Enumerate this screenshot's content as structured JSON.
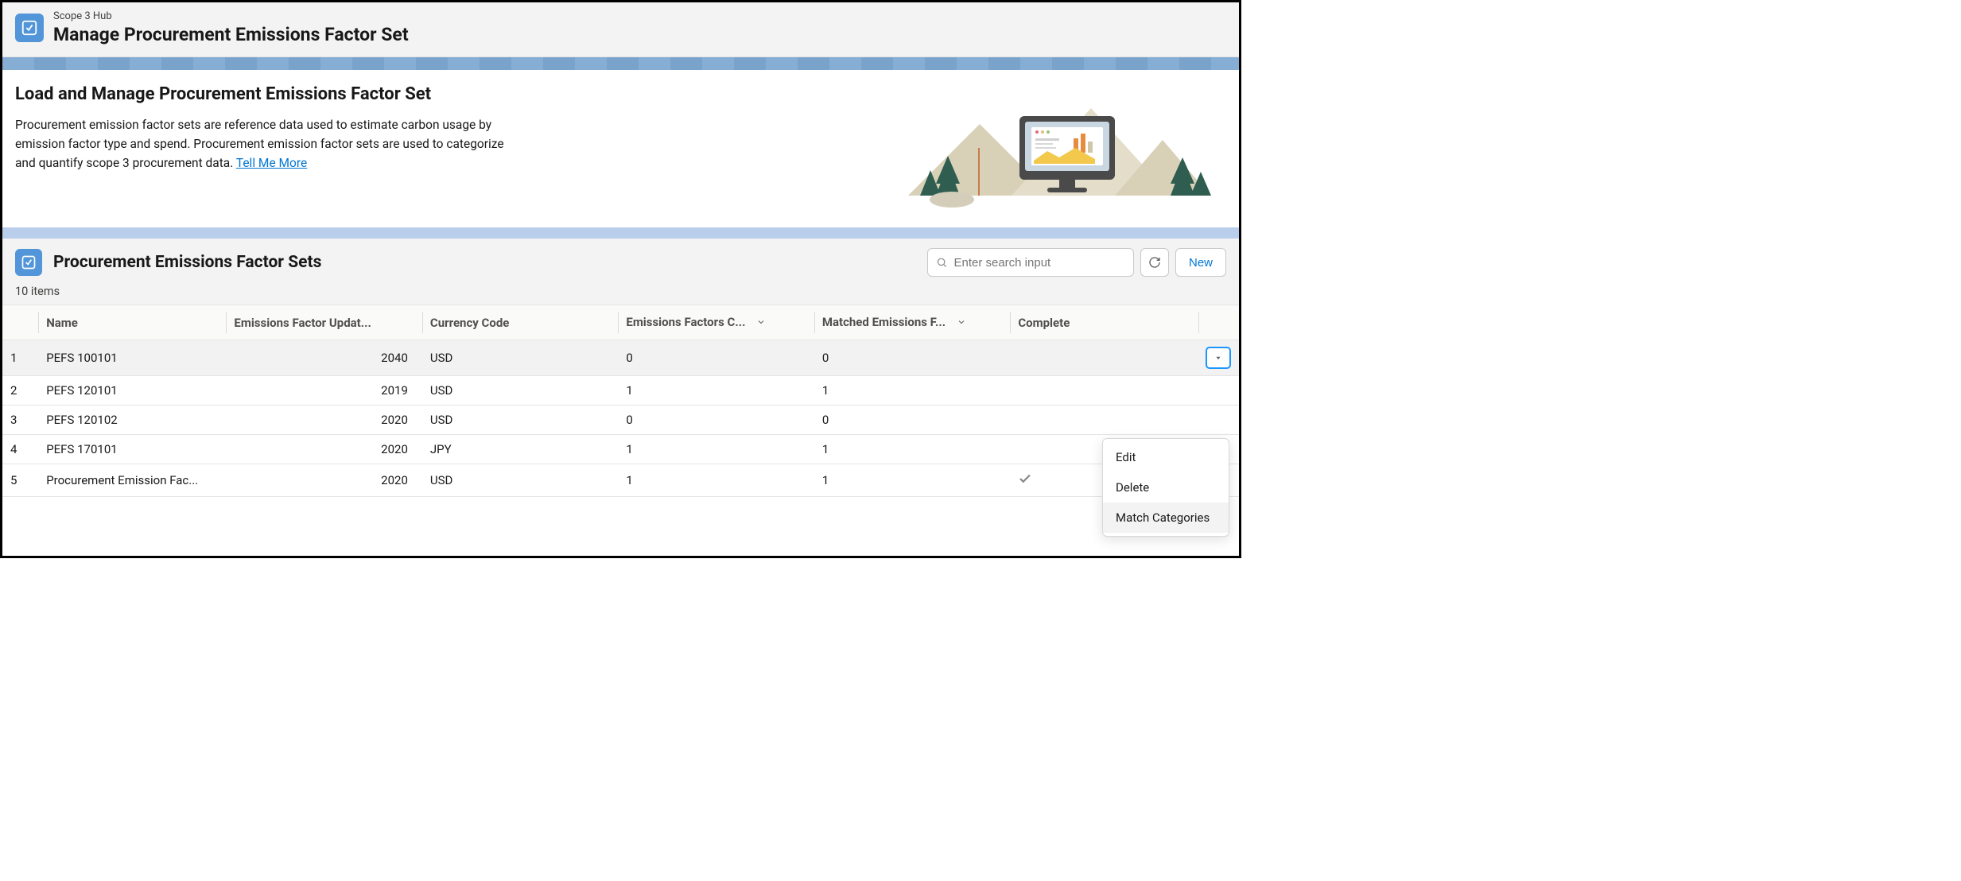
{
  "header": {
    "eyebrow": "Scope 3 Hub",
    "title": "Manage Procurement Emissions Factor Set"
  },
  "intro": {
    "title": "Load and Manage Procurement Emissions Factor Set",
    "description_prefix": "Procurement emission factor sets are reference data used to estimate carbon usage by emission factor type and spend. Procurement emission factor sets are used to categorize and quantify scope 3 procurement data. ",
    "link_label": "Tell Me More"
  },
  "list": {
    "title": "Procurement Emissions Factor Sets",
    "search_placeholder": "Enter search input",
    "new_button": "New",
    "item_count": "10 items"
  },
  "columns": {
    "name": "Name",
    "year": "Emissions Factor Updat...",
    "currency": "Currency Code",
    "efc": "Emissions Factors C...",
    "mef": "Matched Emissions F...",
    "complete": "Complete"
  },
  "rows": [
    {
      "num": "1",
      "name": "PEFS 100101",
      "year": "2040",
      "currency": "USD",
      "efc": "0",
      "mef": "0",
      "complete": false
    },
    {
      "num": "2",
      "name": "PEFS 120101",
      "year": "2019",
      "currency": "USD",
      "efc": "1",
      "mef": "1",
      "complete": false
    },
    {
      "num": "3",
      "name": "PEFS 120102",
      "year": "2020",
      "currency": "USD",
      "efc": "0",
      "mef": "0",
      "complete": false
    },
    {
      "num": "4",
      "name": "PEFS 170101",
      "year": "2020",
      "currency": "JPY",
      "efc": "1",
      "mef": "1",
      "complete": false
    },
    {
      "num": "5",
      "name": "Procurement Emission Fac...",
      "year": "2020",
      "currency": "USD",
      "efc": "1",
      "mef": "1",
      "complete": true
    }
  ],
  "menu": {
    "edit": "Edit",
    "delete": "Delete",
    "match": "Match Categories"
  }
}
